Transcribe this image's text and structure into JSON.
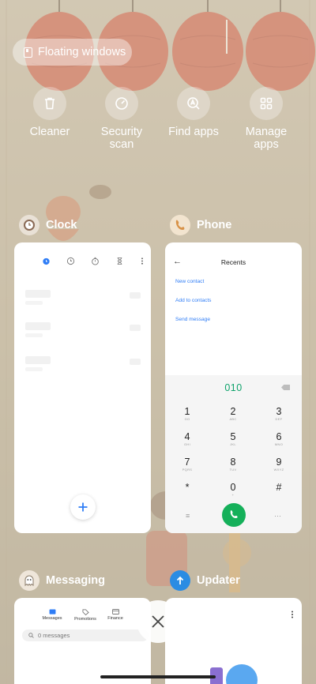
{
  "floating_windows": {
    "label": "Floating windows",
    "icon": "floating-window-icon"
  },
  "quick_actions": [
    {
      "label": "Cleaner",
      "icon": "trash-icon"
    },
    {
      "label": "Security\nscan",
      "icon": "security-scan-icon"
    },
    {
      "label": "Find apps",
      "icon": "find-apps-icon"
    },
    {
      "label": "Manage\napps",
      "icon": "grid-icon"
    }
  ],
  "recent_apps": {
    "clock": {
      "name": "Clock",
      "icon": "clock-app-icon"
    },
    "phone": {
      "name": "Phone",
      "icon": "phone-app-icon",
      "screen_title": "Recents",
      "actions": [
        "New contact",
        "Add to contacts",
        "Send message"
      ],
      "dialed_number": "010",
      "keys": [
        {
          "digit": "1",
          "sub": "GO"
        },
        {
          "digit": "2",
          "sub": "ABC"
        },
        {
          "digit": "3",
          "sub": "DEF"
        },
        {
          "digit": "4",
          "sub": "GHI"
        },
        {
          "digit": "5",
          "sub": "JKL"
        },
        {
          "digit": "6",
          "sub": "MNO"
        },
        {
          "digit": "7",
          "sub": "PQRS"
        },
        {
          "digit": "8",
          "sub": "TUV"
        },
        {
          "digit": "9",
          "sub": "WXYZ"
        },
        {
          "digit": "*",
          "sub": ""
        },
        {
          "digit": "0",
          "sub": "+"
        },
        {
          "digit": "#",
          "sub": ""
        }
      ]
    },
    "messaging": {
      "name": "Messaging",
      "icon": "messaging-app-icon",
      "tabs": [
        "Messages",
        "Promotions",
        "Finance"
      ],
      "search_placeholder": "0 messages"
    },
    "updater": {
      "name": "Updater",
      "icon": "updater-app-icon"
    }
  },
  "colors": {
    "accent_blue": "#2f7df6",
    "call_green": "#15b05a",
    "dial_number_green": "#0fa36b",
    "lantern_red": "#c9563e"
  }
}
